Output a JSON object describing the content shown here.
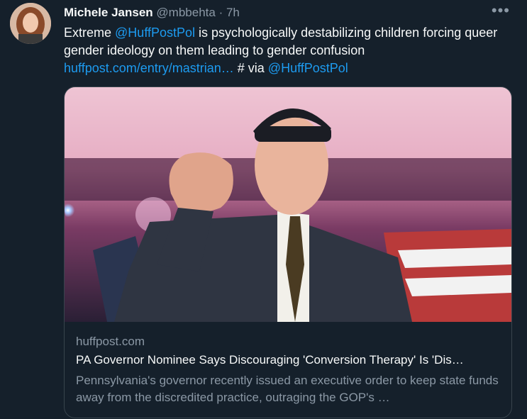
{
  "tweet": {
    "author_name": "Michele Jansen",
    "handle": "@mbbehta",
    "separator": "·",
    "time": "7h",
    "more_label": "•••",
    "text": {
      "prefix": "Extreme ",
      "mention1": "@HuffPostPol",
      "body": " is psychologically destabilizing children forcing queer gender ideology on them leading to gender confusion",
      "url": "huffpost.com/entry/mastrian…",
      "middle": " # via ",
      "mention2": "@HuffPostPol"
    }
  },
  "card": {
    "domain": "huffpost.com",
    "title": "PA Governor Nominee Says Discouraging 'Conversion Therapy' Is 'Dis…",
    "description": "Pennsylvania's governor recently issued an executive order to keep state funds away from the discredited practice, outraging the GOP's …"
  },
  "colors": {
    "background": "#15202b",
    "link": "#1d9bf0",
    "muted": "#8b98a5",
    "border": "#38444d"
  }
}
